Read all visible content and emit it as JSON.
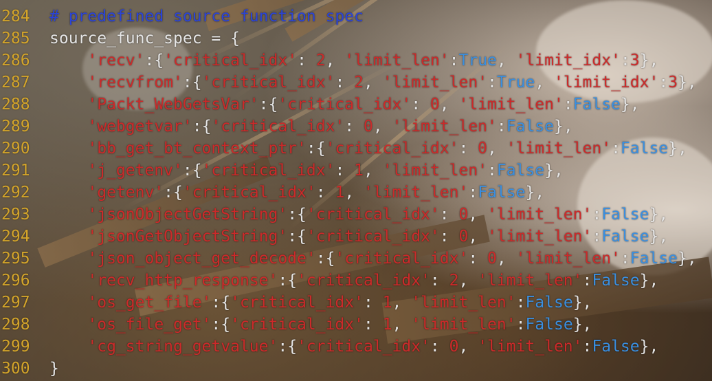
{
  "editor": {
    "lines": [
      {
        "number": "284",
        "tokens": [
          {
            "t": "# predefined source function spec",
            "k": "comment"
          }
        ]
      },
      {
        "number": "285",
        "tokens": [
          {
            "t": "source_func_spec = {",
            "k": "plain"
          }
        ]
      },
      {
        "number": "286",
        "tokens": [
          {
            "t": "    ",
            "k": "plain"
          },
          {
            "t": "'recv'",
            "k": "str"
          },
          {
            "t": ":{",
            "k": "plain"
          },
          {
            "t": "'critical_idx'",
            "k": "str"
          },
          {
            "t": ": ",
            "k": "plain"
          },
          {
            "t": "2",
            "k": "num"
          },
          {
            "t": ", ",
            "k": "plain"
          },
          {
            "t": "'limit_len'",
            "k": "str"
          },
          {
            "t": ":",
            "k": "plain"
          },
          {
            "t": "True",
            "k": "kw"
          },
          {
            "t": ", ",
            "k": "plain"
          },
          {
            "t": "'limit_idx'",
            "k": "str"
          },
          {
            "t": ":",
            "k": "plain"
          },
          {
            "t": "3",
            "k": "num"
          },
          {
            "t": "},",
            "k": "plain"
          }
        ]
      },
      {
        "number": "287",
        "tokens": [
          {
            "t": "    ",
            "k": "plain"
          },
          {
            "t": "'recvfrom'",
            "k": "str"
          },
          {
            "t": ":{",
            "k": "plain"
          },
          {
            "t": "'critical_idx'",
            "k": "str"
          },
          {
            "t": ": ",
            "k": "plain"
          },
          {
            "t": "2",
            "k": "num"
          },
          {
            "t": ", ",
            "k": "plain"
          },
          {
            "t": "'limit_len'",
            "k": "str"
          },
          {
            "t": ":",
            "k": "plain"
          },
          {
            "t": "True",
            "k": "kw"
          },
          {
            "t": ", ",
            "k": "plain"
          },
          {
            "t": "'limit_idx'",
            "k": "str"
          },
          {
            "t": ":",
            "k": "plain"
          },
          {
            "t": "3",
            "k": "num"
          },
          {
            "t": "},",
            "k": "plain"
          }
        ]
      },
      {
        "number": "288",
        "tokens": [
          {
            "t": "    ",
            "k": "plain"
          },
          {
            "t": "'Packt_WebGetsVar'",
            "k": "str"
          },
          {
            "t": ":{",
            "k": "plain"
          },
          {
            "t": "'critical_idx'",
            "k": "str"
          },
          {
            "t": ": ",
            "k": "plain"
          },
          {
            "t": "0",
            "k": "num"
          },
          {
            "t": ", ",
            "k": "plain"
          },
          {
            "t": "'limit_len'",
            "k": "str"
          },
          {
            "t": ":",
            "k": "plain"
          },
          {
            "t": "False",
            "k": "kw"
          },
          {
            "t": "},",
            "k": "plain"
          }
        ]
      },
      {
        "number": "289",
        "tokens": [
          {
            "t": "    ",
            "k": "plain"
          },
          {
            "t": "'webgetvar'",
            "k": "str"
          },
          {
            "t": ":{",
            "k": "plain"
          },
          {
            "t": "'critical_idx'",
            "k": "str"
          },
          {
            "t": ": ",
            "k": "plain"
          },
          {
            "t": "0",
            "k": "num"
          },
          {
            "t": ", ",
            "k": "plain"
          },
          {
            "t": "'limit_len'",
            "k": "str"
          },
          {
            "t": ":",
            "k": "plain"
          },
          {
            "t": "False",
            "k": "kw"
          },
          {
            "t": "},",
            "k": "plain"
          }
        ]
      },
      {
        "number": "290",
        "tokens": [
          {
            "t": "    ",
            "k": "plain"
          },
          {
            "t": "'bb_get_bt_context_ptr'",
            "k": "str"
          },
          {
            "t": ":{",
            "k": "plain"
          },
          {
            "t": "'critical_idx'",
            "k": "str"
          },
          {
            "t": ": ",
            "k": "plain"
          },
          {
            "t": "0",
            "k": "num"
          },
          {
            "t": ", ",
            "k": "plain"
          },
          {
            "t": "'limit_len'",
            "k": "str"
          },
          {
            "t": ":",
            "k": "plain"
          },
          {
            "t": "False",
            "k": "kw"
          },
          {
            "t": "},",
            "k": "plain"
          }
        ]
      },
      {
        "number": "291",
        "tokens": [
          {
            "t": "    ",
            "k": "plain"
          },
          {
            "t": "'j_getenv'",
            "k": "str"
          },
          {
            "t": ":{",
            "k": "plain"
          },
          {
            "t": "'critical_idx'",
            "k": "str"
          },
          {
            "t": ": ",
            "k": "plain"
          },
          {
            "t": "1",
            "k": "num"
          },
          {
            "t": ", ",
            "k": "plain"
          },
          {
            "t": "'limit_len'",
            "k": "str"
          },
          {
            "t": ":",
            "k": "plain"
          },
          {
            "t": "False",
            "k": "kw"
          },
          {
            "t": "},",
            "k": "plain"
          }
        ]
      },
      {
        "number": "292",
        "tokens": [
          {
            "t": "    ",
            "k": "plain"
          },
          {
            "t": "'getenv'",
            "k": "str"
          },
          {
            "t": ":{",
            "k": "plain"
          },
          {
            "t": "'critical_idx'",
            "k": "str"
          },
          {
            "t": ": ",
            "k": "plain"
          },
          {
            "t": "1",
            "k": "num"
          },
          {
            "t": ", ",
            "k": "plain"
          },
          {
            "t": "'limit_len'",
            "k": "str"
          },
          {
            "t": ":",
            "k": "plain"
          },
          {
            "t": "False",
            "k": "kw"
          },
          {
            "t": "},",
            "k": "plain"
          }
        ]
      },
      {
        "number": "293",
        "tokens": [
          {
            "t": "    ",
            "k": "plain"
          },
          {
            "t": "'jsonObjectGetString'",
            "k": "str"
          },
          {
            "t": ":{",
            "k": "plain"
          },
          {
            "t": "'critical_idx'",
            "k": "str"
          },
          {
            "t": ": ",
            "k": "plain"
          },
          {
            "t": "0",
            "k": "num"
          },
          {
            "t": ", ",
            "k": "plain"
          },
          {
            "t": "'limit_len'",
            "k": "str"
          },
          {
            "t": ":",
            "k": "plain"
          },
          {
            "t": "False",
            "k": "kw"
          },
          {
            "t": "},",
            "k": "plain"
          }
        ]
      },
      {
        "number": "294",
        "tokens": [
          {
            "t": "    ",
            "k": "plain"
          },
          {
            "t": "'jsonGetObjectString'",
            "k": "str"
          },
          {
            "t": ":{",
            "k": "plain"
          },
          {
            "t": "'critical_idx'",
            "k": "str"
          },
          {
            "t": ": ",
            "k": "plain"
          },
          {
            "t": "0",
            "k": "num"
          },
          {
            "t": ", ",
            "k": "plain"
          },
          {
            "t": "'limit_len'",
            "k": "str"
          },
          {
            "t": ":",
            "k": "plain"
          },
          {
            "t": "False",
            "k": "kw"
          },
          {
            "t": "},",
            "k": "plain"
          }
        ]
      },
      {
        "number": "295",
        "tokens": [
          {
            "t": "    ",
            "k": "plain"
          },
          {
            "t": "'json_object_get_decode'",
            "k": "str"
          },
          {
            "t": ":{",
            "k": "plain"
          },
          {
            "t": "'critical_idx'",
            "k": "str"
          },
          {
            "t": ": ",
            "k": "plain"
          },
          {
            "t": "0",
            "k": "num"
          },
          {
            "t": ", ",
            "k": "plain"
          },
          {
            "t": "'limit_len'",
            "k": "str"
          },
          {
            "t": ":",
            "k": "plain"
          },
          {
            "t": "False",
            "k": "kw"
          },
          {
            "t": "},",
            "k": "plain"
          }
        ]
      },
      {
        "number": "296",
        "tokens": [
          {
            "t": "    ",
            "k": "plain"
          },
          {
            "t": "'recv_http_response'",
            "k": "str"
          },
          {
            "t": ":{",
            "k": "plain"
          },
          {
            "t": "'critical_idx'",
            "k": "str"
          },
          {
            "t": ": ",
            "k": "plain"
          },
          {
            "t": "2",
            "k": "num"
          },
          {
            "t": ", ",
            "k": "plain"
          },
          {
            "t": "'limit_len'",
            "k": "str"
          },
          {
            "t": ":",
            "k": "plain"
          },
          {
            "t": "False",
            "k": "kw"
          },
          {
            "t": "},",
            "k": "plain"
          }
        ]
      },
      {
        "number": "297",
        "tokens": [
          {
            "t": "    ",
            "k": "plain"
          },
          {
            "t": "'os_get_file'",
            "k": "str"
          },
          {
            "t": ":{",
            "k": "plain"
          },
          {
            "t": "'critical_idx'",
            "k": "str"
          },
          {
            "t": ": ",
            "k": "plain"
          },
          {
            "t": "1",
            "k": "num"
          },
          {
            "t": ", ",
            "k": "plain"
          },
          {
            "t": "'limit_len'",
            "k": "str"
          },
          {
            "t": ":",
            "k": "plain"
          },
          {
            "t": "False",
            "k": "kw"
          },
          {
            "t": "},",
            "k": "plain"
          }
        ]
      },
      {
        "number": "298",
        "tokens": [
          {
            "t": "    ",
            "k": "plain"
          },
          {
            "t": "'os_file_get'",
            "k": "str"
          },
          {
            "t": ":{",
            "k": "plain"
          },
          {
            "t": "'critical_idx'",
            "k": "str"
          },
          {
            "t": ": ",
            "k": "plain"
          },
          {
            "t": "1",
            "k": "num"
          },
          {
            "t": ", ",
            "k": "plain"
          },
          {
            "t": "'limit_len'",
            "k": "str"
          },
          {
            "t": ":",
            "k": "plain"
          },
          {
            "t": "False",
            "k": "kw"
          },
          {
            "t": "},",
            "k": "plain"
          }
        ]
      },
      {
        "number": "299",
        "tokens": [
          {
            "t": "    ",
            "k": "plain"
          },
          {
            "t": "'cg_string_getvalue'",
            "k": "str"
          },
          {
            "t": ":{",
            "k": "plain"
          },
          {
            "t": "'critical_idx'",
            "k": "str"
          },
          {
            "t": ": ",
            "k": "plain"
          },
          {
            "t": "0",
            "k": "num"
          },
          {
            "t": ", ",
            "k": "plain"
          },
          {
            "t": "'limit_len'",
            "k": "str"
          },
          {
            "t": ":",
            "k": "plain"
          },
          {
            "t": "False",
            "k": "kw"
          },
          {
            "t": "},",
            "k": "plain"
          }
        ]
      },
      {
        "number": "300",
        "tokens": [
          {
            "t": "}",
            "k": "plain"
          }
        ]
      }
    ]
  },
  "colors": {
    "line_number": "#d4a52a",
    "comment": "#2a44d8",
    "string": "#cc2a2a",
    "keyword": "#3a8fe0",
    "plain": "#e6e6e6"
  }
}
